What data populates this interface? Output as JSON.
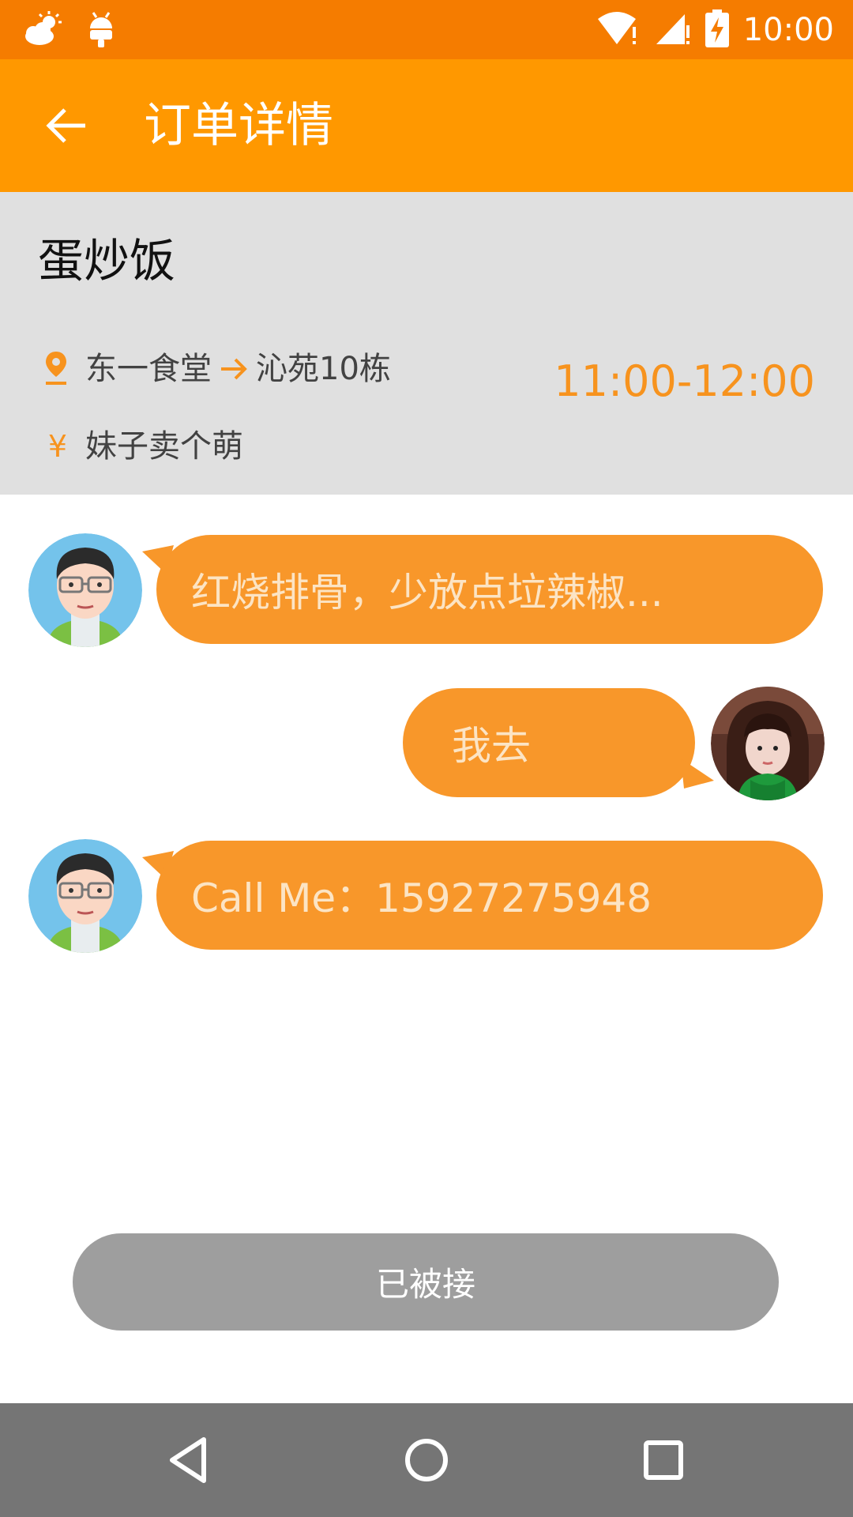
{
  "status_bar": {
    "time": "10:00",
    "left_icons": [
      "weather-cloud-sun-icon",
      "android-icon"
    ],
    "right_icons": [
      "wifi-icon",
      "cell-signal-icon",
      "battery-charging-icon"
    ]
  },
  "app_bar": {
    "back_icon": "arrow-left-icon",
    "title": "订单详情"
  },
  "order": {
    "dish": "蛋炒饭",
    "from": "东一食堂",
    "to": "沁苑10栋",
    "time_range": "11:00-12:00",
    "note": "妹子卖个萌",
    "icons": {
      "location": "location-pin-icon",
      "arrow": "arrow-right-icon",
      "price": "yen-icon"
    }
  },
  "messages": [
    {
      "side": "left",
      "avatar": "male-cartoon-avatar",
      "text": "红烧排骨，少放点垃辣椒..."
    },
    {
      "side": "right",
      "avatar": "female-photo-avatar",
      "text": "我去"
    },
    {
      "side": "left",
      "avatar": "male-cartoon-avatar",
      "text": "Call Me：15927275948"
    }
  ],
  "action_button": {
    "label": "已被接"
  },
  "nav_bar": {
    "buttons": [
      "back-triangle-icon",
      "home-circle-icon",
      "recents-square-icon"
    ]
  },
  "colors": {
    "status_bar": "#F57C00",
    "app_bar": "#FF9800",
    "accent": "#F7931E",
    "bubble": "#F8972A",
    "panel": "#E0E0E0",
    "button_disabled": "#9E9E9E",
    "nav_bar": "#757575"
  }
}
